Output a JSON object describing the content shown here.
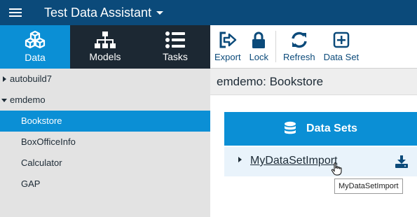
{
  "app": {
    "title": "Test Data Assistant"
  },
  "nav_tabs": [
    {
      "label": "Data",
      "icon": "cubes-icon",
      "active": true
    },
    {
      "label": "Models",
      "icon": "sitemap-icon",
      "active": false
    },
    {
      "label": "Tasks",
      "icon": "list-icon",
      "active": false
    }
  ],
  "toolbar": [
    {
      "label": "Export",
      "icon": "export-icon"
    },
    {
      "label": "Lock",
      "icon": "lock-icon"
    },
    {
      "label": "Refresh",
      "icon": "refresh-icon"
    },
    {
      "label": "Data Set",
      "icon": "add-square-icon"
    }
  ],
  "tree": {
    "projects": [
      {
        "label": "autobuild7",
        "expanded": false
      },
      {
        "label": "emdemo",
        "expanded": true,
        "children": [
          {
            "label": "Bookstore",
            "selected": true
          },
          {
            "label": "BoxOfficeInfo",
            "selected": false
          },
          {
            "label": "Calculator",
            "selected": false
          },
          {
            "label": "GAP",
            "selected": false
          }
        ]
      }
    ]
  },
  "main": {
    "breadcrumb": "emdemo: Bookstore",
    "panel_title": "Data Sets",
    "datasets": [
      {
        "label": "MyDataSetImport"
      }
    ],
    "tooltip": "MyDataSetImport"
  },
  "colors": {
    "header": "#0b4a7a",
    "accent": "#0b8fd5",
    "nav_dark": "#1c2833",
    "sidebar": "#e3e3e3"
  }
}
